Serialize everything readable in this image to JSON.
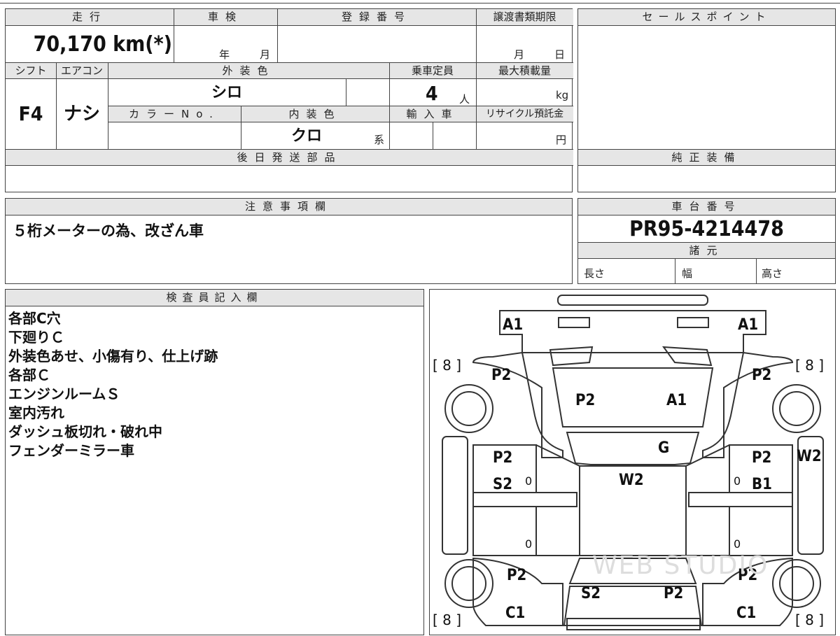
{
  "mileage": {
    "label": "走行",
    "value": "70,170 km(*)"
  },
  "inspection": {
    "label": "車検",
    "year_unit": "年",
    "month_unit": "月"
  },
  "registration": {
    "label": "登録番号",
    "value": ""
  },
  "transfer": {
    "label": "譲渡書類期限",
    "month_unit": "月",
    "day_unit": "日"
  },
  "sales_point": {
    "label": "セールスポイント"
  },
  "shift": {
    "label": "シフト",
    "value": "F4"
  },
  "aircon": {
    "label": "エアコン",
    "value": "ナシ"
  },
  "exterior_color": {
    "label": "外装色",
    "value": "シロ"
  },
  "capacity": {
    "label": "乗車定員",
    "value": "4",
    "unit": "人"
  },
  "max_load": {
    "label": "最大積載量",
    "unit": "kg"
  },
  "color_no": {
    "label": "カラーNo."
  },
  "interior_color": {
    "label": "内装色",
    "value": "クロ",
    "unit": "系"
  },
  "import": {
    "label": "輸入車"
  },
  "recycle": {
    "label": "リサイクル預託金",
    "unit": "円"
  },
  "later_parts": {
    "label": "後日発送部品"
  },
  "genuine_equipment": {
    "label": "純正装備"
  },
  "notes": {
    "label": "注意事項欄",
    "text": "５桁メーターの為、改ざん車"
  },
  "chassis": {
    "label": "車台番号",
    "value": "PR95-4214478"
  },
  "specs": {
    "label": "諸元",
    "length": "長さ",
    "width": "幅",
    "height": "高さ"
  },
  "inspector": {
    "label": "検査員記入欄",
    "lines": [
      "各部C穴",
      "下廻りＣ",
      "外装色あせ、小傷有り、仕上げ跡",
      "各部Ｃ",
      "エンジンルームＳ",
      "室内汚れ",
      "ダッシュ板切れ・破れ中",
      "フェンダーミラー車"
    ]
  },
  "diagram": {
    "front_left": "A1",
    "front_right": "A1",
    "tire_fl": "[ 8 ]",
    "tire_fr": "[ 8 ]",
    "tire_rl": "[ 8 ]",
    "tire_rr": "[ 8 ]",
    "fender_fl": "P2",
    "fender_fr": "P2",
    "hood_left": "P2",
    "hood_right": "A1",
    "windshield": "G",
    "roof": "W2",
    "door_fl_1": "P2",
    "door_fl_2": "S2",
    "door_fr_1": "P2",
    "door_fr_2": "B1",
    "side_right": "W2",
    "zero_1": "0",
    "zero_2": "0",
    "zero_3": "0",
    "zero_4": "0",
    "quarter_rl": "P2",
    "quarter_rr": "P2",
    "trunk_left": "S2",
    "trunk_right": "P2",
    "rear_rl": "C1",
    "rear_rr": "C1",
    "watermark": "WEB STUDIO"
  }
}
